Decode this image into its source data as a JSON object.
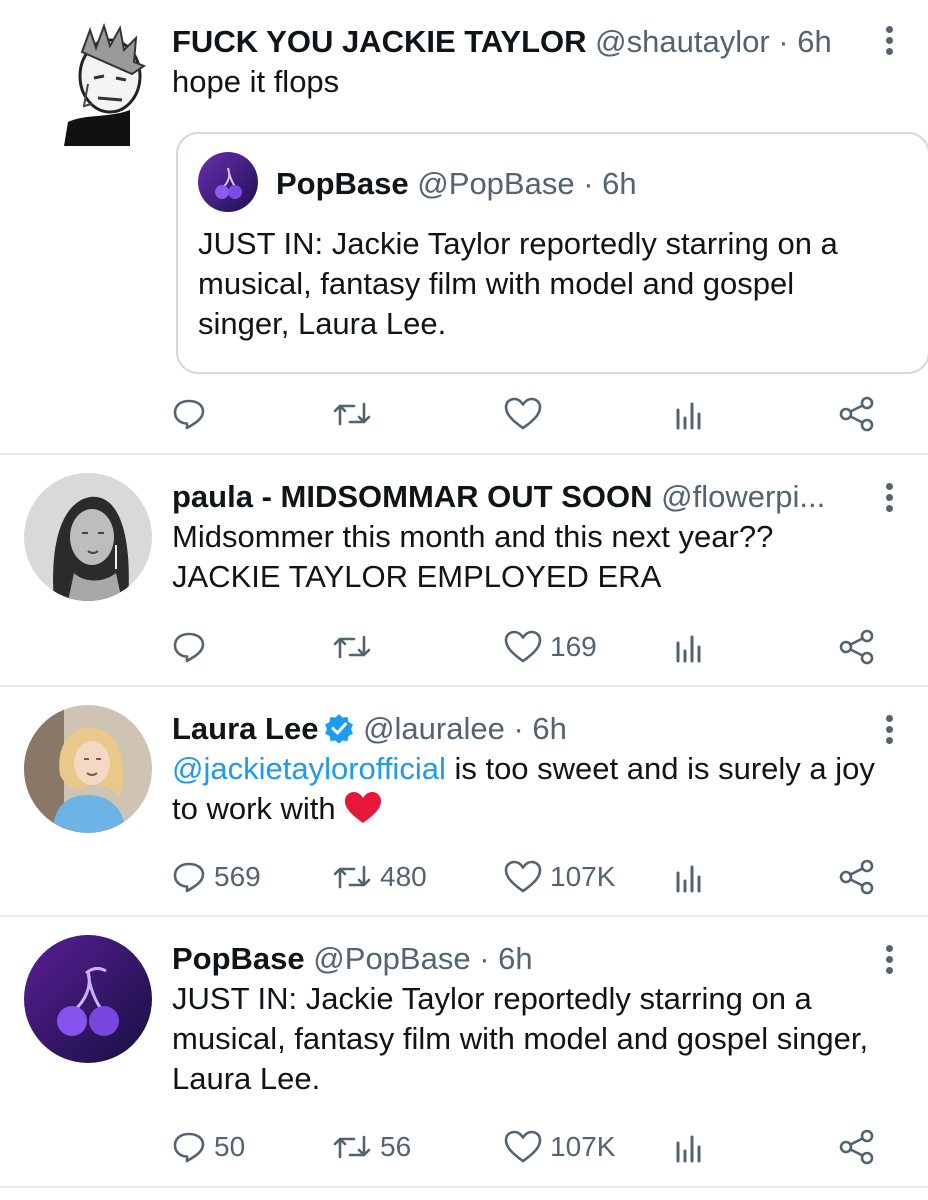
{
  "tweets": [
    {
      "name": "FUCK YOU JACKIE TAYLOR",
      "handle": "@shautaylor",
      "sep": " · ",
      "time": "6h",
      "text": "hope it flops",
      "quote": {
        "name": "PopBase",
        "handle": "@PopBase",
        "sep": " · ",
        "time": "6h",
        "text": "JUST IN: Jackie Taylor reportedly starring on a musical, fantasy film with model and gospel singer, Laura Lee."
      },
      "replies": "",
      "retweets": "",
      "likes": ""
    },
    {
      "name": "paula - MIDSOMMAR OUT SOON",
      "handle": "@flowerpi...",
      "text_line1": "Midsommer this month and this next year??",
      "text_line2": "JACKIE TAYLOR EMPLOYED ERA",
      "replies": "",
      "retweets": "",
      "likes": "169"
    },
    {
      "name": "Laura Lee",
      "handle": "@lauralee",
      "sep": " · ",
      "time": "6h",
      "mention": "@jackietaylorofficial",
      "text": " is too sweet and is surely a joy to work with ",
      "replies": "569",
      "retweets": "480",
      "likes": "107K"
    },
    {
      "name": "PopBase",
      "handle": "@PopBase",
      "sep": " · ",
      "time": "6h",
      "text": "JUST IN: Jackie Taylor reportedly starring on a musical, fantasy film with model and gospel singer, Laura Lee.",
      "replies": "50",
      "retweets": "56",
      "likes": "107K"
    }
  ],
  "icons": {
    "reply": "reply-icon",
    "retweet": "retweet-icon",
    "like": "heart-icon",
    "views": "analytics-icon",
    "share": "share-icon",
    "more": "more-vertical-icon",
    "verified": "verified-badge-icon",
    "emoji": "red-heart-emoji"
  },
  "colors": {
    "text": "#0f1419",
    "muted": "#536471",
    "link": "#1d9bf0",
    "divider": "#e6ecf0",
    "verified": "#1d9bf0",
    "emoji_heart": "#e8173a"
  }
}
